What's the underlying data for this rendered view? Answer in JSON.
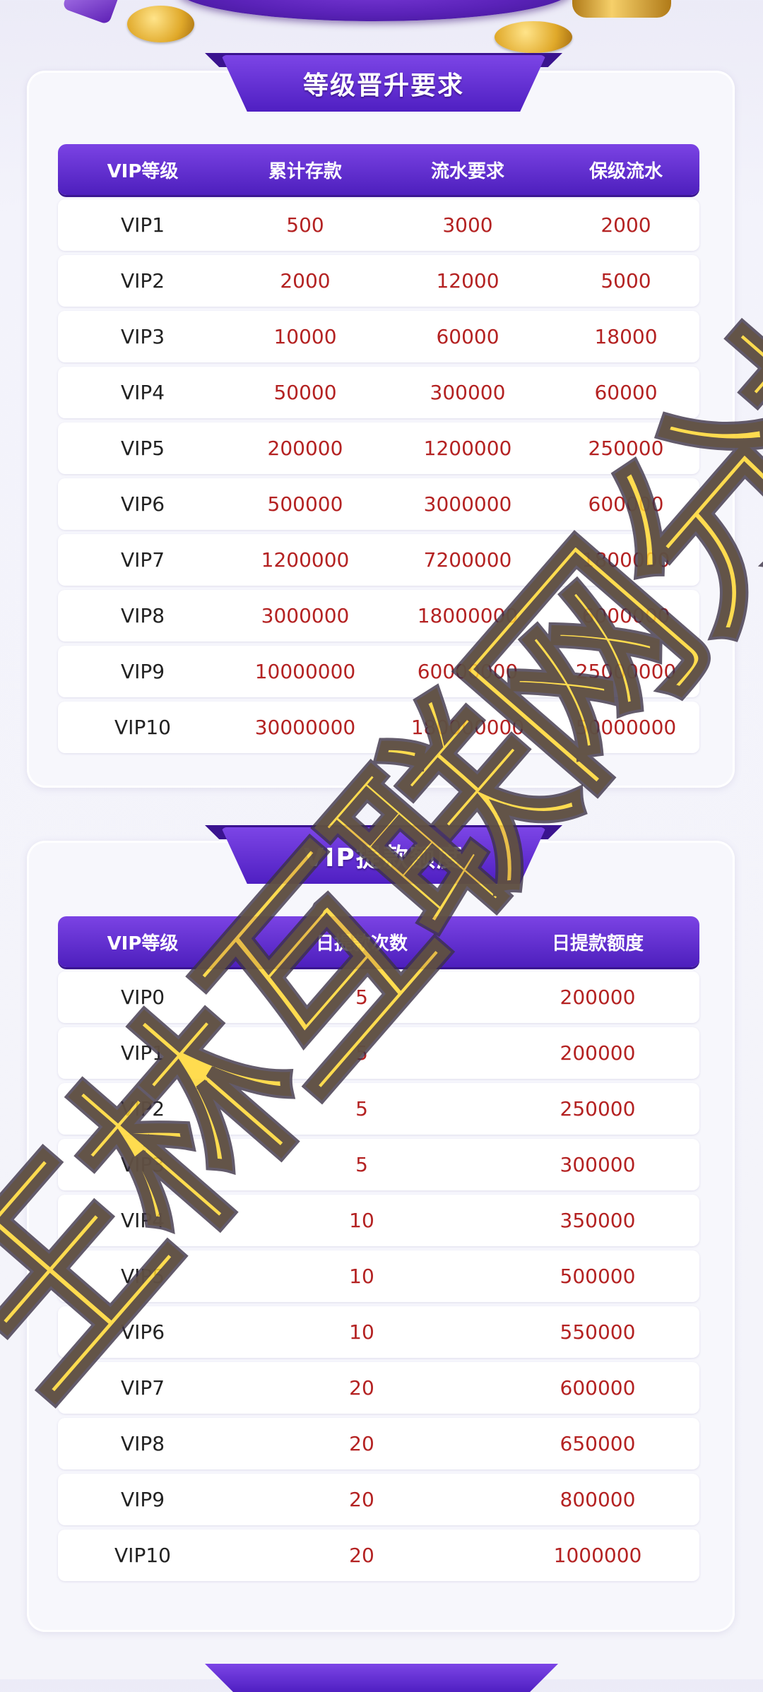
{
  "colors": {
    "accent": "#5a26c9",
    "value_red": "#b42222",
    "watermark": "#ffd630"
  },
  "upgrade_section": {
    "title": "等级晋升要求",
    "headers": [
      "VIP等级",
      "累计存款",
      "流水要求",
      "保级流水"
    ],
    "rows": [
      [
        "VIP1",
        "500",
        "3000",
        "2000"
      ],
      [
        "VIP2",
        "2000",
        "12000",
        "5000"
      ],
      [
        "VIP3",
        "10000",
        "60000",
        "18000"
      ],
      [
        "VIP4",
        "50000",
        "300000",
        "60000"
      ],
      [
        "VIP5",
        "200000",
        "1200000",
        "250000"
      ],
      [
        "VIP6",
        "500000",
        "3000000",
        "600000"
      ],
      [
        "VIP7",
        "1200000",
        "7200000",
        "1800000"
      ],
      [
        "VIP8",
        "3000000",
        "18000000",
        "6000000"
      ],
      [
        "VIP9",
        "10000000",
        "60000000",
        "25000000"
      ],
      [
        "VIP10",
        "30000000",
        "180000000",
        "50000000"
      ]
    ]
  },
  "withdraw_section": {
    "title": "VIP提款额度",
    "headers": [
      "VIP等级",
      "日提款次数",
      "日提款额度"
    ],
    "rows": [
      [
        "VIP0",
        "5",
        "200000"
      ],
      [
        "VIP1",
        "5",
        "200000"
      ],
      [
        "VIP2",
        "5",
        "250000"
      ],
      [
        "VIP3",
        "5",
        "300000"
      ],
      [
        "VIP4",
        "10",
        "350000"
      ],
      [
        "VIP5",
        "10",
        "500000"
      ],
      [
        "VIP6",
        "10",
        "550000"
      ],
      [
        "VIP7",
        "20",
        "600000"
      ],
      [
        "VIP8",
        "20",
        "650000"
      ],
      [
        "VIP9",
        "20",
        "800000"
      ],
      [
        "VIP10",
        "20",
        "1000000"
      ]
    ]
  },
  "watermark": {
    "text": "王林互联网分析"
  }
}
